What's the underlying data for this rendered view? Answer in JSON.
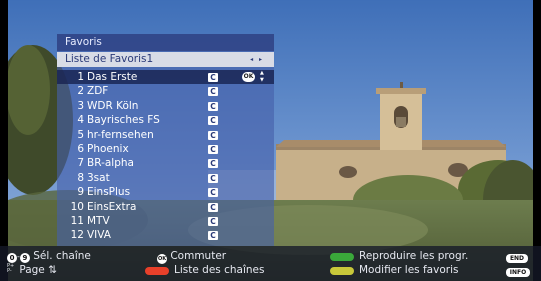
{
  "panel": {
    "title": "Favoris",
    "list_name": "Liste de Favoris1",
    "list_arrows": "◂ ▸",
    "channels": [
      {
        "num": "1",
        "name": "Das Erste",
        "badge": "C",
        "selected": true
      },
      {
        "num": "2",
        "name": "ZDF",
        "badge": "C"
      },
      {
        "num": "3",
        "name": "WDR Köln",
        "badge": "C"
      },
      {
        "num": "4",
        "name": "Bayrisches FS",
        "badge": "C"
      },
      {
        "num": "5",
        "name": "hr-fernsehen",
        "badge": "C"
      },
      {
        "num": "6",
        "name": "Phoenix",
        "badge": "C"
      },
      {
        "num": "7",
        "name": "BR-alpha",
        "badge": "C"
      },
      {
        "num": "8",
        "name": "3sat",
        "badge": "C"
      },
      {
        "num": "9",
        "name": "EinsPlus",
        "badge": "C"
      },
      {
        "num": "10",
        "name": "EinsExtra",
        "badge": "C"
      },
      {
        "num": "11",
        "name": "MTV",
        "badge": "C"
      },
      {
        "num": "12",
        "name": "VIVA",
        "badge": "C"
      }
    ],
    "ok_label": "OK"
  },
  "bottom_bar": {
    "digit_start": "0",
    "digit_sep": "-",
    "digit_end": "9",
    "select_channel": "Sél. chaîne",
    "page_key_top": "P+",
    "page_key_bottom": "P-",
    "page": "Page ⇅",
    "ok_key": "OK",
    "switch": "Commuter",
    "red_action": "Liste des chaînes",
    "green_action": "Reproduire les progr.",
    "yellow_action": "Modifier les favoris",
    "end_key": "END",
    "info_key": "INFO"
  },
  "colors": {
    "red": "#e8402a",
    "green": "#3aa83a",
    "yellow": "#c8c83a",
    "panel_selected": "#19234f",
    "list_header_bg": "#d8dce6"
  }
}
